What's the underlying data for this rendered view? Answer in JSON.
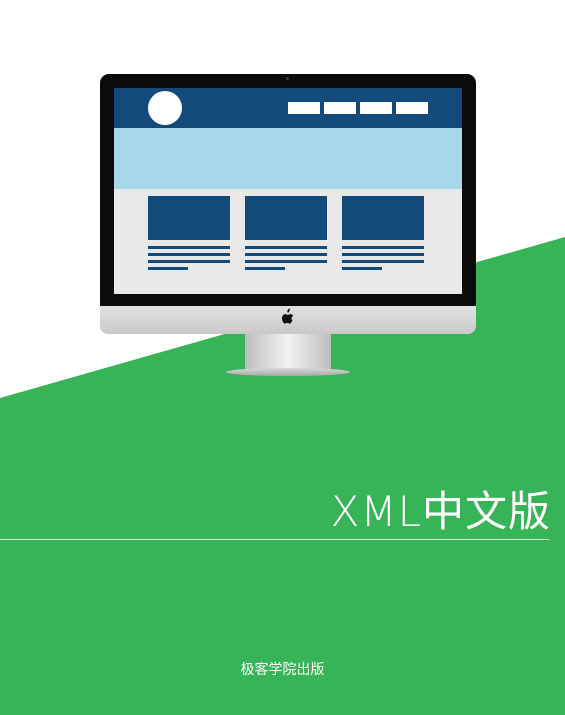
{
  "cover": {
    "title": "XML中文版",
    "publisher": "极客学院出版"
  },
  "colors": {
    "background_green": "#37b457",
    "background_white": "#ffffff",
    "site_header_blue": "#124a7a",
    "site_hero_lightblue": "#a7d8ea"
  },
  "illustration": {
    "monitor_logo": "apple-icon",
    "nav_button_count": 4,
    "card_count": 3
  }
}
